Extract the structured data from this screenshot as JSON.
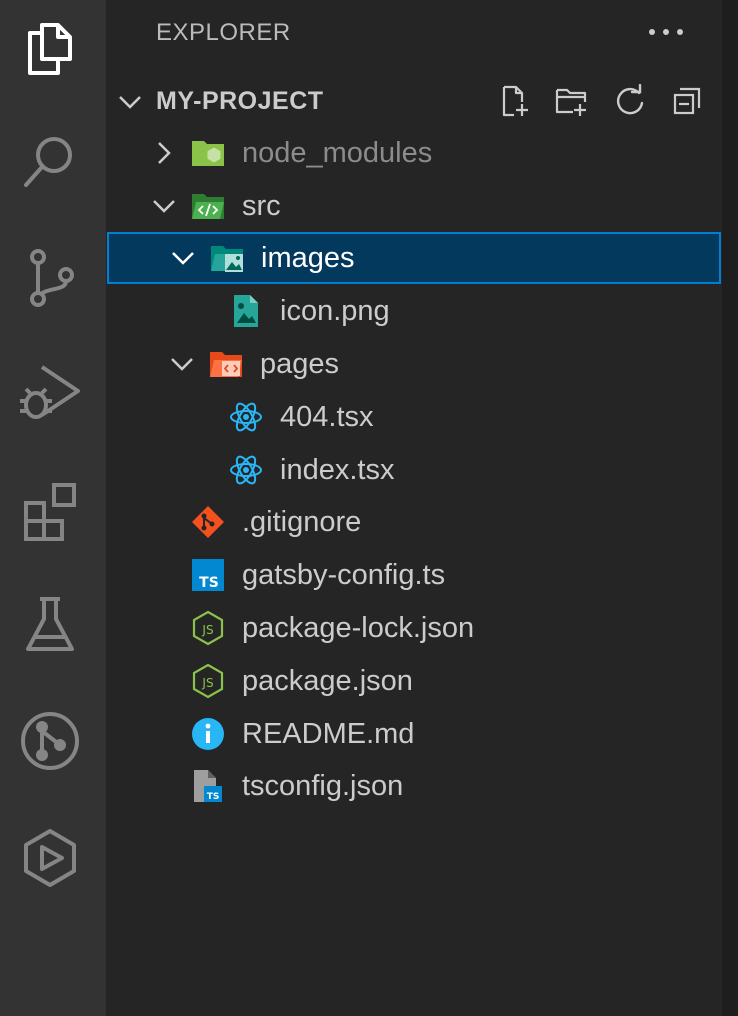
{
  "activity_bar": {
    "items": [
      {
        "icon": "files-icon",
        "active": true
      },
      {
        "icon": "search-icon"
      },
      {
        "icon": "source-control-icon"
      },
      {
        "icon": "run-debug-icon"
      },
      {
        "icon": "extensions-icon"
      },
      {
        "icon": "testing-icon"
      },
      {
        "icon": "git-graph-icon"
      },
      {
        "icon": "remote-explorer-icon"
      }
    ]
  },
  "sidebar": {
    "title": "EXPLORER",
    "more_icon": "ellipsis-icon",
    "section": {
      "title": "MY-PROJECT",
      "actions": [
        "new-file-icon",
        "new-folder-icon",
        "refresh-icon",
        "collapse-all-icon"
      ]
    },
    "tree": [
      {
        "label": "node_modules",
        "type": "folder",
        "expanded": false,
        "depth": 0,
        "icon": "node-folder-icon",
        "dimmed": true
      },
      {
        "label": "src",
        "type": "folder",
        "expanded": true,
        "depth": 0,
        "icon": "src-folder-icon"
      },
      {
        "label": "images",
        "type": "folder",
        "expanded": true,
        "depth": 1,
        "icon": "images-folder-icon",
        "selected": true
      },
      {
        "label": "icon.png",
        "type": "file",
        "depth": 2,
        "icon": "image-file-icon"
      },
      {
        "label": "pages",
        "type": "folder",
        "expanded": true,
        "depth": 1,
        "icon": "pages-folder-icon"
      },
      {
        "label": "404.tsx",
        "type": "file",
        "depth": 2,
        "icon": "react-icon"
      },
      {
        "label": "index.tsx",
        "type": "file",
        "depth": 2,
        "icon": "react-icon"
      },
      {
        "label": ".gitignore",
        "type": "file",
        "depth": 0,
        "icon": "git-icon"
      },
      {
        "label": "gatsby-config.ts",
        "type": "file",
        "depth": 0,
        "icon": "typescript-icon"
      },
      {
        "label": "package-lock.json",
        "type": "file",
        "depth": 0,
        "icon": "nodejs-icon"
      },
      {
        "label": "package.json",
        "type": "file",
        "depth": 0,
        "icon": "nodejs-icon"
      },
      {
        "label": "README.md",
        "type": "file",
        "depth": 0,
        "icon": "info-icon"
      },
      {
        "label": "tsconfig.json",
        "type": "file",
        "depth": 0,
        "icon": "tsconfig-icon"
      }
    ]
  },
  "colors": {
    "selection_bg": "#04395e",
    "selection_border": "#007fd4",
    "sidebar_bg": "#252526",
    "activity_bg": "#333333"
  }
}
